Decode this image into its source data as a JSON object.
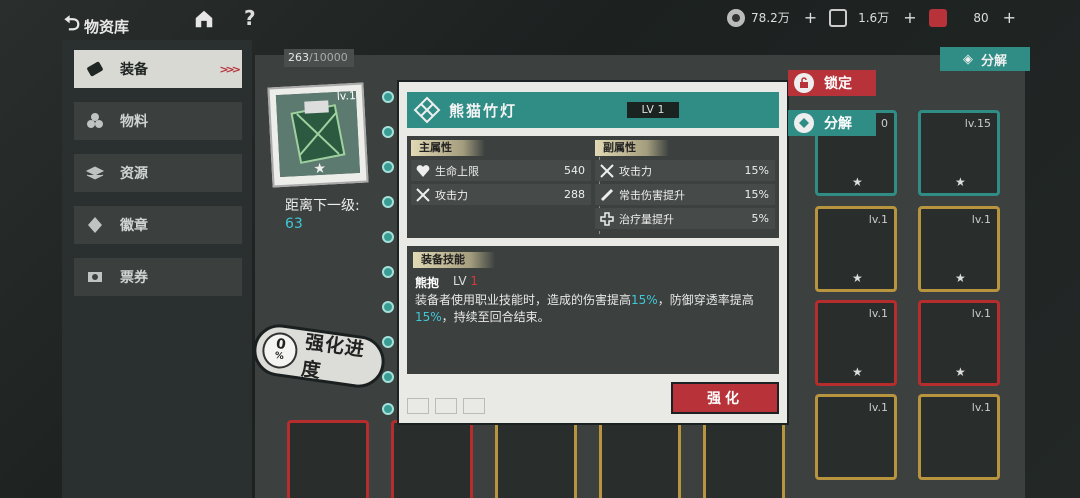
{
  "topbar": {
    "title": "物资库",
    "help": "?",
    "currencies": [
      {
        "icon": "coin-icon",
        "value": "78.2万",
        "plus": "+"
      },
      {
        "icon": "chip-icon",
        "value": "1.6万",
        "plus": "+"
      },
      {
        "icon": "ticket-icon",
        "value": "80",
        "plus": "+"
      }
    ]
  },
  "sidebar": {
    "items": [
      {
        "label": "装备",
        "icon": "equipment-icon",
        "active": true
      },
      {
        "label": "物料",
        "icon": "materials-icon"
      },
      {
        "label": "资源",
        "icon": "resources-icon"
      },
      {
        "label": "徽章",
        "icon": "badge-icon"
      },
      {
        "label": "票券",
        "icon": "ticket-icon"
      }
    ]
  },
  "inventory": {
    "count": "263",
    "max": "/10000",
    "decompose_label": "分解",
    "grid_levels": [
      "lv.15",
      "lv.1",
      "lv.1",
      "lv.1",
      "lv.1",
      "lv.1",
      "lv.1",
      "0"
    ]
  },
  "selected": {
    "level": "lv.1",
    "next_level_label": "距离下一级:",
    "next_level_value": "63",
    "progress_value": "0",
    "progress_unit": "%",
    "progress_label": "强化进度"
  },
  "detail": {
    "name": "熊猫竹灯",
    "level": "LV 1",
    "main_attr_title": "主属性",
    "main_attrs": [
      {
        "icon": "heart-icon",
        "label": "生命上限",
        "value": "540"
      },
      {
        "icon": "crossed-swords-icon",
        "label": "攻击力",
        "value": "288"
      }
    ],
    "sub_attr_title": "副属性",
    "sub_attrs": [
      {
        "icon": "crossed-swords-icon",
        "label": "攻击力",
        "value": "15%"
      },
      {
        "icon": "sword-icon",
        "label": "常击伤害提升",
        "value": "15%"
      },
      {
        "icon": "heal-cross-icon",
        "label": "治疗量提升",
        "value": "5%"
      }
    ],
    "skill_title": "装备技能",
    "skill_name": "熊抱",
    "skill_lv_prefix": "LV",
    "skill_lv_value": "1",
    "skill_desc_1": "装备者使用职业技能时，造成的伤害提高",
    "skill_hl_1": "15%",
    "skill_desc_2": "，防御穿透率提高",
    "skill_hl_2": "15%",
    "skill_desc_3": "，持续至回合结束。",
    "enhance_label": "强化",
    "lock_label": "锁定",
    "decompose_label": "分解"
  },
  "colors": {
    "teal": "#2f8d86",
    "red": "#b8323a",
    "highlight": "#3ec8d6"
  }
}
